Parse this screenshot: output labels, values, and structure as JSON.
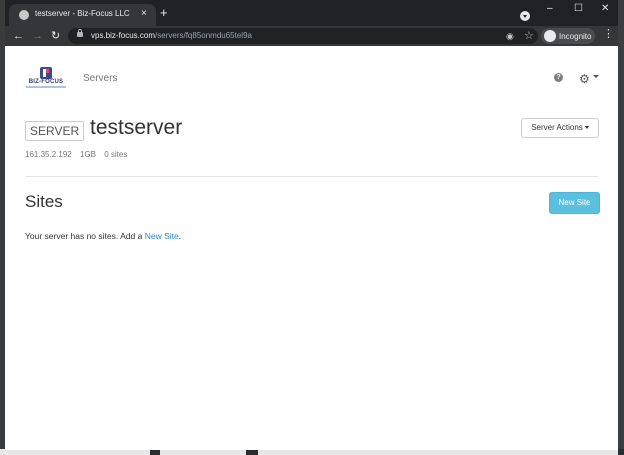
{
  "browser": {
    "tab_title": "testserver - Biz-Focus LLC",
    "tab_close": "×",
    "new_tab": "+",
    "window_controls": [
      "–",
      "☐",
      "✕"
    ],
    "nav": {
      "back": "←",
      "forward": "→",
      "reload": "↻"
    },
    "url_host": "vps.biz-focus.com",
    "url_path": "/servers/fq85onmdu65tel9a",
    "incognito_label": "Incognito",
    "menu": "⋮"
  },
  "header": {
    "logo_text": "BIZ-FOCUS",
    "nav_servers": "Servers",
    "help_glyph": "?",
    "settings_glyph": "⚙"
  },
  "server": {
    "label": "SERVER",
    "name": "testserver",
    "actions_label": "Server Actions",
    "ip": "161.35.2.192",
    "memory": "1GB",
    "sites_count": "0 sites"
  },
  "sites": {
    "heading": "Sites",
    "new_site_button": "New Site",
    "empty_prefix": "Your server has no sites. Add a ",
    "empty_link": "New Site",
    "empty_suffix": "."
  },
  "colors": {
    "accent_button": "#5bc0de",
    "link": "#2a88bd",
    "browser_frame": "#202124"
  }
}
